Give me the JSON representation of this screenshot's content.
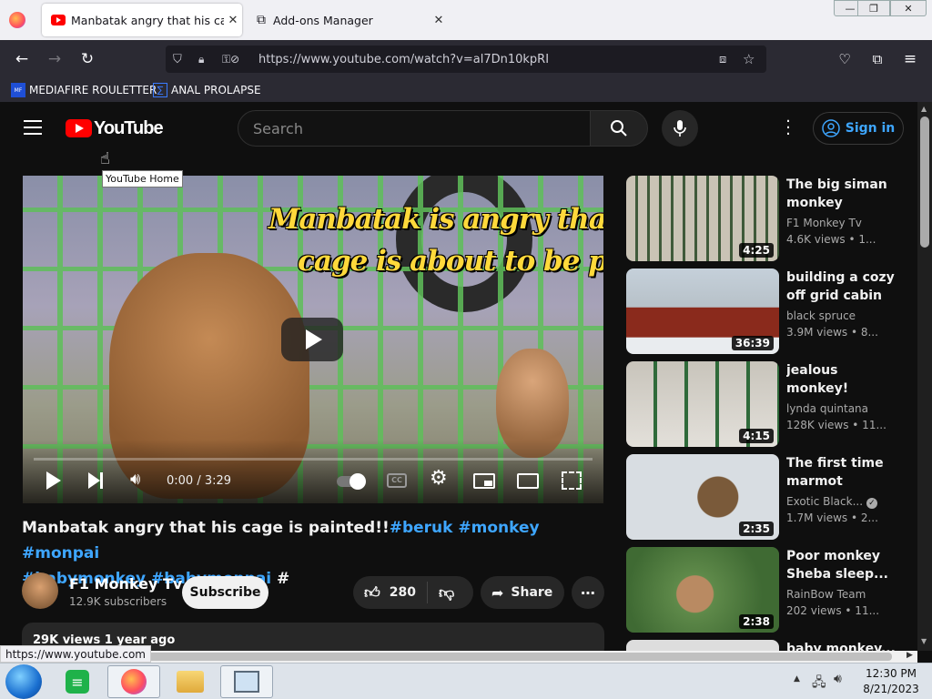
{
  "browser": {
    "tabs": [
      {
        "label": "Manbatak angry that his cage is painted!!",
        "active": true
      },
      {
        "label": "Add-ons Manager",
        "active": false
      }
    ],
    "url": "https://www.youtube.com/watch?v=al7Dn10kpRI",
    "bookmarks": [
      "MEDIAFIRE ROULETTER",
      "ANAL PROLAPSE"
    ],
    "status_url": "https://www.youtube.com"
  },
  "youtube": {
    "logo_text": "YouTube",
    "logo_tooltip": "YouTube Home",
    "search_placeholder": "Search",
    "sign_in": "Sign in",
    "video": {
      "overlay_line1": "Manbatak is angry that his",
      "overlay_line2": "cage is about to be painted!",
      "time": "0:00 / 3:29",
      "progress": 0,
      "title_text": "Manbatak angry that his cage is painted!!",
      "tags": [
        "#beruk",
        "#monkey",
        "#monpai",
        "#babymonkey",
        "#babymonpai",
        "#"
      ],
      "channel": "F1 Monkey Tv",
      "subscribers": "12.9K subscribers",
      "subscribe": "Subscribe",
      "likes": "280",
      "share": "Share",
      "description_meta": "29K views  1 year ago"
    },
    "related": [
      {
        "title": "The big siman monkey open...",
        "channel": "F1 Monkey Tv",
        "meta": "4.6K views • 1...",
        "duration": "4:25"
      },
      {
        "title": "building a cozy off grid cabin ...",
        "channel": "black spruce",
        "meta": "3.9M views • 8...",
        "duration": "36:39"
      },
      {
        "title": "jealous monkey!",
        "channel": "lynda quintana",
        "meta": "128K views • 11...",
        "duration": "4:15"
      },
      {
        "title": "The first time marmot bathe...",
        "channel": "Exotic Black...",
        "meta": "1.7M views • 2...",
        "duration": "2:35"
      },
      {
        "title": "Poor monkey Sheba sleep...",
        "channel": "RainBow Team",
        "meta": "202 views • 11...",
        "duration": "2:38"
      },
      {
        "title": "baby monkey...",
        "channel": "",
        "meta": "",
        "duration": ""
      }
    ]
  },
  "taskbar": {
    "time": "12:30 PM",
    "date": "8/21/2023"
  },
  "colors": {
    "accent": "#3ea6ff",
    "yt_red": "#ff0000",
    "bg": "#0f0f0f"
  }
}
